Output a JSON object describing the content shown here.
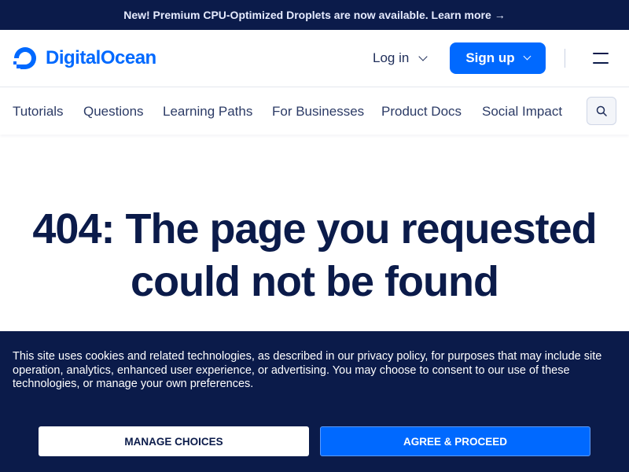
{
  "banner": {
    "text": "New! Premium CPU-Optimized Droplets are now available. Learn more",
    "arrow": "→"
  },
  "header": {
    "logo_text": "DigitalOcean",
    "login_label": "Log in",
    "signup_label": "Sign up"
  },
  "nav": {
    "items": [
      "Tutorials",
      "Questions",
      "Learning Paths",
      "For Businesses",
      "Product Docs",
      "Social Impact"
    ]
  },
  "main": {
    "title": "404: The page you requested could not be found"
  },
  "cookie": {
    "text": "This site uses cookies and related technologies, as described in our privacy policy, for purposes that may include site operation, analytics, enhanced user experience, or advertising. You may choose to consent to our use of these technologies, or manage your own preferences.",
    "manage_label": "MANAGE CHOICES",
    "agree_label": "AGREE & PROCEED"
  },
  "colors": {
    "brand_blue": "#0069ff",
    "navy": "#0b1b4a"
  },
  "icons": [
    "logo-icon",
    "chevron-down-icon",
    "menu-icon",
    "search-icon",
    "arrow-right-icon"
  ]
}
